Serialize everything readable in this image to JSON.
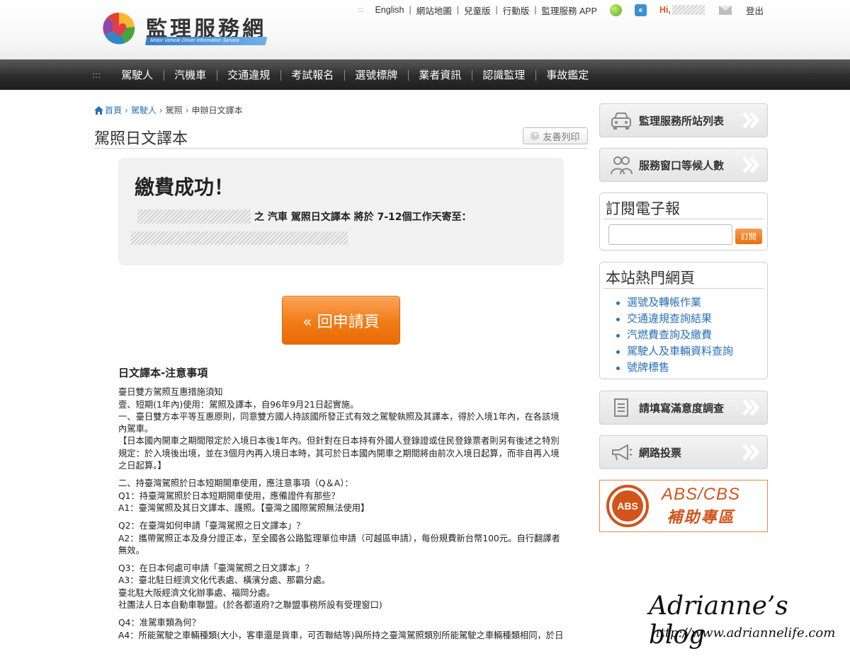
{
  "header": {
    "logo_text": "監理服務網",
    "logo_sub": "Motor Vehicle Driver Information Service",
    "top_links": [
      "English",
      "網站地圖",
      "兒童版",
      "行動版",
      "監理服務 APP"
    ],
    "dots": ":::",
    "greeting": "Hi,",
    "logout": "登出"
  },
  "nav": {
    "dots": ":::",
    "items": [
      "駕駛人",
      "汽機車",
      "交通違規",
      "考試報名",
      "選號標牌",
      "業者資訊",
      "認識監理",
      "事故鑑定"
    ]
  },
  "breadcrumb": {
    "home": "首頁",
    "level1": "駕駛人",
    "level2": "駕照",
    "current": "申辦日文譯本"
  },
  "page": {
    "title": "駕照日文譯本",
    "print_label": "友善列印"
  },
  "success": {
    "title": "繳費成功！",
    "message": "之 汽車 駕照日文譯本 將於 7-12個工作天寄至："
  },
  "back_button": "« 回申請頁",
  "notes": {
    "heading": "日文譯本-注意事項",
    "lines": [
      "臺日雙方駕照互惠措施須知",
      "壹、短期(1年內)使用：駕照及譯本，自96年9月21日起實施。",
      "一、臺日雙方本平等互惠原則，同意雙方國人持該國所發正式有效之駕駛執照及其譯本，得於入境1年內，在各該境內駕車。",
      "【日本國內開車之期間限定於入境日本後1年內。但針對在日本持有外國人登錄證或住民登錄票者則另有後述之特別規定：於入境後出境，並在3個月內再入境日本時，其可於日本國內開車之期間將由前次入境日起算，而非自再入境之日起算。】",
      "",
      "二、持臺灣駕照於日本短期開車使用，應注意事項（Q＆A）：",
      "Q1：持臺灣駕照於日本短期開車使用，應備證件有那些？",
      "A1：臺灣駕照及其日文譯本、護照。【臺灣之國際駕照無法使用】",
      "",
      "Q2：在臺灣如何申請「臺灣駕照之日文譯本」？",
      "A2：攜帶駕照正本及身分證正本，至全國各公路監理單位申請（可越區申請），每份規費新台幣100元。自行翻譯者無效。",
      "",
      "Q3：在日本何處可申請「臺灣駕照之日文譯本」？",
      "A3：臺北駐日經濟文化代表處、橫濱分處、那霸分處。",
      "臺北駐大阪經濟文化辦事處、福岡分處。",
      "社團法人日本自動車聯盟。(於各都道府?之聯盟事務所設有受理窗口)",
      "",
      "Q4：准駕車類為何？",
      "A4：所能駕駛之車輛種類(大小，客車還是貨車，可否聯結等)與所持之臺灣駕照類別所能駕駛之車輛種類相同，於日"
    ]
  },
  "sidebar": {
    "station_list": "監理服務所站列表",
    "queue": "服務窗口等候人數",
    "newsletter_title": "訂閱電子報",
    "subscribe": "訂閱",
    "hot_title": "本站熱門網頁",
    "hot_links": [
      "選號及轉帳作業",
      "交通違規查詢結果",
      "汽燃費查詢及繳費",
      "駕駛人及車輛資料查詢",
      "號牌標售"
    ],
    "survey": "請填寫滿意度調查",
    "vote": "網路投票",
    "abs_badge": "ABS",
    "abs_title": "ABS/CBS",
    "abs_sub": "補助專區"
  },
  "watermark": {
    "name": "Adrianne’s blog",
    "url": "http://www.adriannelife.com"
  },
  "colors": {
    "accent_orange": "#f27b14",
    "link_blue": "#2a6fb7",
    "nav_dark": "#2c2c2c"
  }
}
